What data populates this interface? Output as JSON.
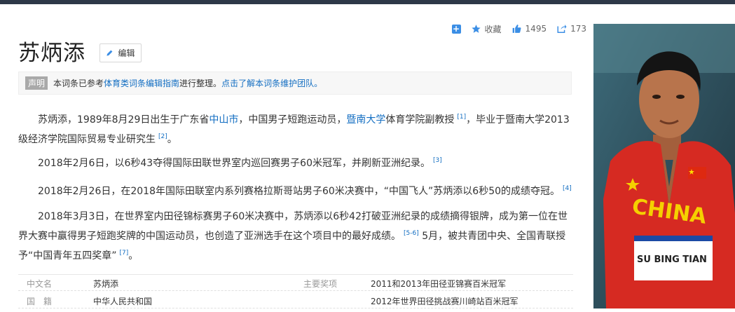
{
  "toolbar": {
    "favorite_label": "收藏",
    "like_count": "1495",
    "share_count": "173"
  },
  "article": {
    "title": "苏炳添",
    "edit_label": "编辑"
  },
  "notice": {
    "badge": "声明",
    "text1": "本词条已参考",
    "link1": "体育类词条编辑指南",
    "text2": "进行整理。",
    "link2": "点击了解本词条维护团队。"
  },
  "paragraphs": {
    "p1": {
      "t1": "苏炳添，1989年8月29日出生于广东省",
      "link1": "中山市",
      "t2": "，中国男子短跑运动员，",
      "link2": "暨南大学",
      "t3": "体育学院副教授",
      "ref1": "[1]",
      "t4": "，毕业于暨南大学2013级经济学院国际贸易专业研究生",
      "ref2": "[2]",
      "t5": "。"
    },
    "p2": {
      "text": "2018年2月6日，以6秒43夺得国际田联世界室内巡回赛男子60米冠军，并刷新亚洲纪录。",
      "ref": "[3]"
    },
    "p3": {
      "text": "2018年2月26日，在2018年国际田联室内系列赛格拉斯哥站男子60米决赛中，“中国飞人”苏炳添以6秒50的成绩夺冠。",
      "ref": "[4]"
    },
    "p4": {
      "t1": "2018年3月3日，在世界室内田径锦标赛男子60米决赛中，苏炳添以6秒42打破亚洲纪录的成绩摘得银牌，成为第一位在世界大赛中赢得男子短跑奖牌的中国运动员，也创造了亚洲选手在这个项目中的最好成绩。",
      "ref": "[5-6]",
      "t2": "5月，被共青团中央、全国青联授予“中国青年五四奖章”",
      "ref2": "[7]",
      "t3": "。"
    }
  },
  "infobox": {
    "row1": {
      "key1": "中文名",
      "val1": "苏炳添",
      "key2": "主要奖项",
      "val2": "2011和2013年田径亚锦赛百米冠军"
    },
    "row2": {
      "key1": "国　籍",
      "val1": "中华人民共和国",
      "val2": "2012年世界田径挑战赛川崎站百米冠军"
    }
  },
  "photo": {
    "jersey_text": "CHINA",
    "bib_text": "SU BING TIAN"
  },
  "colors": {
    "link": "#136ec2",
    "accent_blue": "#3b8ee5",
    "jersey_red": "#d62a22"
  }
}
